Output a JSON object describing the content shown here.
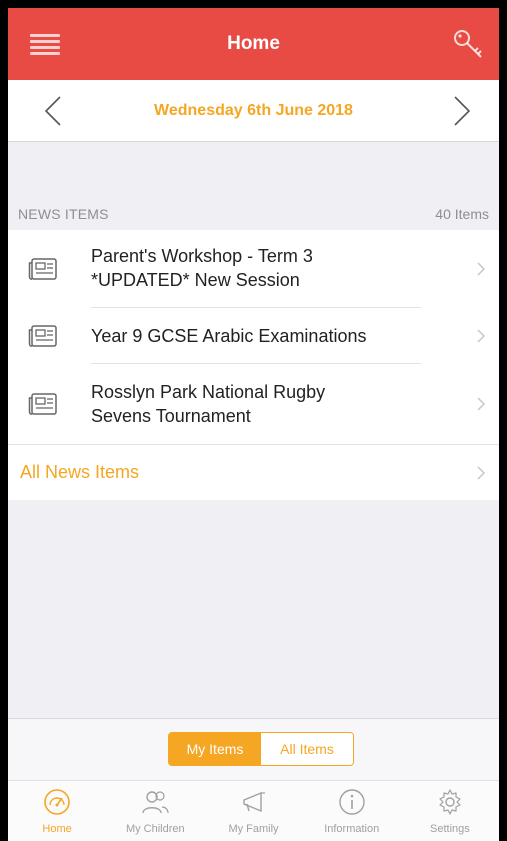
{
  "header": {
    "title": "Home"
  },
  "date_bar": {
    "date": "Wednesday 6th June 2018"
  },
  "news": {
    "section_title": "NEWS ITEMS",
    "count_label": "40 Items",
    "items": [
      {
        "line1": "Parent's Workshop - Term 3",
        "line2": "*UPDATED* New Session"
      },
      {
        "line1": "Year 9 GCSE Arabic Examinations",
        "line2": ""
      },
      {
        "line1": "Rosslyn Park National Rugby",
        "line2": "Sevens Tournament"
      }
    ],
    "all_label": "All News Items"
  },
  "segment": {
    "my_items": "My Items",
    "all_items": "All Items",
    "selected": "My Items"
  },
  "tabs": [
    {
      "label": "Home",
      "icon": "home-dashboard-icon",
      "active": true
    },
    {
      "label": "My Children",
      "icon": "children-icon",
      "active": false
    },
    {
      "label": "My Family",
      "icon": "megaphone-icon",
      "active": false
    },
    {
      "label": "Information",
      "icon": "info-icon",
      "active": false
    },
    {
      "label": "Settings",
      "icon": "gear-icon",
      "active": false
    }
  ],
  "colors": {
    "header_red": "#e84a44",
    "accent_orange": "#f5a623",
    "background_gray": "#efeff4",
    "tab_inactive": "#a0a0a5"
  }
}
